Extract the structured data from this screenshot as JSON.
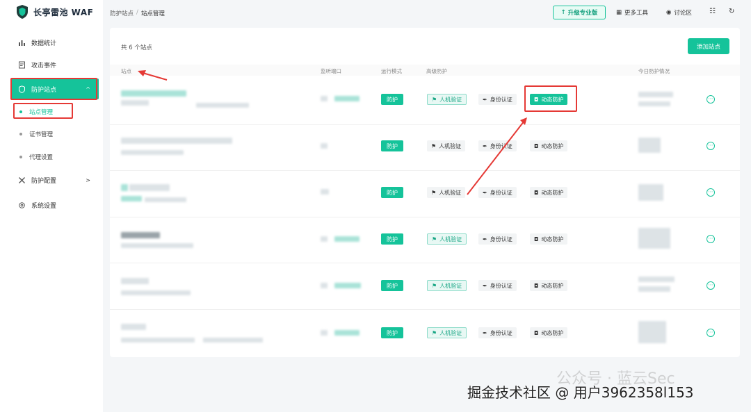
{
  "app": {
    "title": "长亭雷池 WAF"
  },
  "colors": {
    "accent": "#15c39a",
    "highlight": "#e53935"
  },
  "sidebar": {
    "items": [
      {
        "label": "数据统计",
        "icon": "bar-chart-icon"
      },
      {
        "label": "攻击事件",
        "icon": "document-icon"
      },
      {
        "label": "防护站点",
        "icon": "shield-icon",
        "active": true,
        "expanded": true
      },
      {
        "label": "防护配置",
        "icon": "tools-icon"
      },
      {
        "label": "系统设置",
        "icon": "gear-icon"
      }
    ],
    "sub_items": [
      {
        "label": "站点管理",
        "active": true
      },
      {
        "label": "证书管理"
      },
      {
        "label": "代理设置"
      }
    ]
  },
  "topbar": {
    "breadcrumb": [
      "防护站点",
      "站点管理"
    ],
    "upgrade_label": "升级专业版",
    "more_tools": "更多工具",
    "forum": "讨论区"
  },
  "main": {
    "site_count": "共 6 个站点",
    "add_button": "添加站点",
    "columns": [
      "站点",
      "监听端口",
      "运行模式",
      "高级防护",
      "今日防护情况"
    ],
    "rows": [
      {
        "mode": "防护",
        "human_verify": "人机验证",
        "auth": "身份认证",
        "dynamic": "动态防护",
        "human_on": true,
        "dynamic_on": true
      },
      {
        "mode": "防护",
        "human_verify": "人机验证",
        "auth": "身份认证",
        "dynamic": "动态防护",
        "human_on": false,
        "dynamic_on": false
      },
      {
        "mode": "防护",
        "human_verify": "人机验证",
        "auth": "身份认证",
        "dynamic": "动态防护",
        "human_on": false,
        "dynamic_on": false
      },
      {
        "mode": "防护",
        "human_verify": "人机验证",
        "auth": "身份认证",
        "dynamic": "动态防护",
        "human_on": true,
        "dynamic_on": false
      },
      {
        "mode": "防护",
        "human_verify": "人机验证",
        "auth": "身份认证",
        "dynamic": "动态防护",
        "human_on": true,
        "dynamic_on": false
      },
      {
        "mode": "防护",
        "human_verify": "人机验证",
        "auth": "身份认证",
        "dynamic": "动态防护",
        "human_on": true,
        "dynamic_on": false
      }
    ]
  },
  "watermark": {
    "line1": "公众号 · 蓝云Sec",
    "line2": "掘金技术社区 @ 用户3962358l153"
  }
}
